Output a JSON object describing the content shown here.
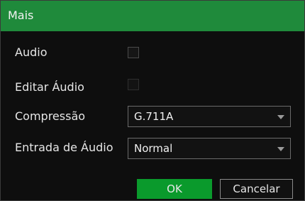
{
  "dialog": {
    "title": "Mais"
  },
  "fields": {
    "audio": {
      "label": "Audio",
      "checked": false
    },
    "edit_audio": {
      "label": "Editar Áudio",
      "checked": false,
      "enabled": false
    },
    "compression": {
      "label": "Compressão",
      "value": "G.711A"
    },
    "audio_input": {
      "label": "Entrada de Áudio",
      "value": "Normal"
    }
  },
  "buttons": {
    "ok_label": "OK",
    "cancel_label": "Cancelar"
  },
  "colors": {
    "title_bar": "#1f8a3b",
    "ok_button": "#0a9a2c"
  }
}
